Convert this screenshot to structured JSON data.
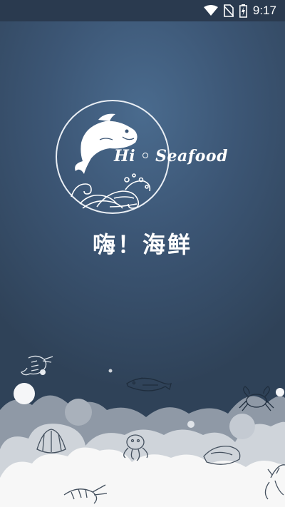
{
  "status_bar": {
    "time": "9:17",
    "icons": [
      "wifi-icon",
      "no-sim-icon",
      "battery-charging-icon"
    ]
  },
  "logo": {
    "text_hi": "Hi",
    "text_seafood": "Seafood",
    "icon": "fish-waves-logo"
  },
  "brand_name": "嗨！海鲜",
  "colors": {
    "background_center": "#4a6b8e",
    "background_edge": "#2f4258",
    "status_bar": "#2a3a4f",
    "cloud_light": "#f7f7f7",
    "cloud_mid": "#cfd4da",
    "cloud_dark": "#8f99a6"
  },
  "decorations": [
    "shrimp-icon",
    "fish-icon",
    "crab-icon",
    "shell-icon",
    "octopus-icon",
    "oyster-icon",
    "lobster-icon",
    "bubble-icon"
  ]
}
